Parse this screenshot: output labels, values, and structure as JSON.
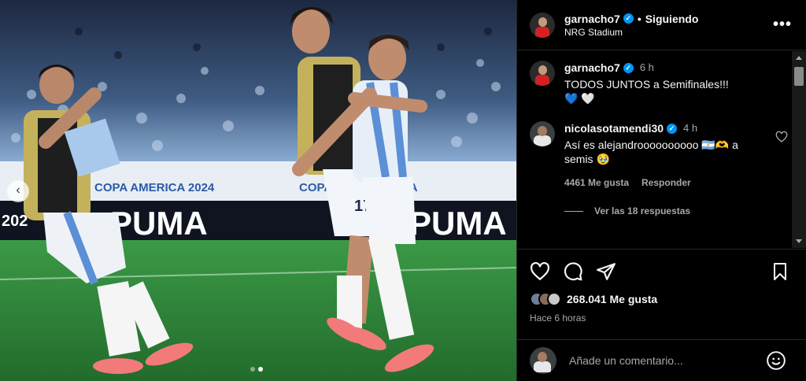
{
  "post": {
    "username": "garnacho7",
    "separator": "•",
    "follow_label": "Siguiendo",
    "location": "NRG Stadium",
    "more_label": "•••"
  },
  "photo": {
    "ad_board_text_1": "COPA AMERICA 2024",
    "ad_board_text_2": "COPA AMERICA USA",
    "puma_text_1": "PUMA",
    "puma_text_2": "PUMA",
    "year_text": "202",
    "shirt_number": "17",
    "slide_count": 2,
    "active_slide": 2
  },
  "caption": {
    "username": "garnacho7",
    "time": "6 h",
    "text": "TODOS JUNTOS a Semifinales!!! 💙 🤍"
  },
  "comments": [
    {
      "username": "nicolasotamendi30",
      "time": "4 h",
      "text": "Así es alejandroooooooooo 🇦🇷🫶 a semis 🥹",
      "likes": "4461 Me gusta",
      "reply_label": "Responder",
      "view_replies": "Ver las 18 respuestas"
    }
  ],
  "actions": {
    "likes_count": "268.041 Me gusta",
    "time_ago": "Hace 6 horas"
  },
  "add_comment": {
    "placeholder": "Añade un comentario..."
  },
  "icons": {
    "like": "heart-icon",
    "comment": "comment-icon",
    "share": "share-icon",
    "save": "bookmark-icon",
    "emoji": "emoji-icon",
    "prev": "chevron-left-icon"
  },
  "colors": {
    "background": "#000000",
    "verified": "#0095f6",
    "secondary_text": "#a8a8a8",
    "pitch_green": "#2f8a3a"
  }
}
